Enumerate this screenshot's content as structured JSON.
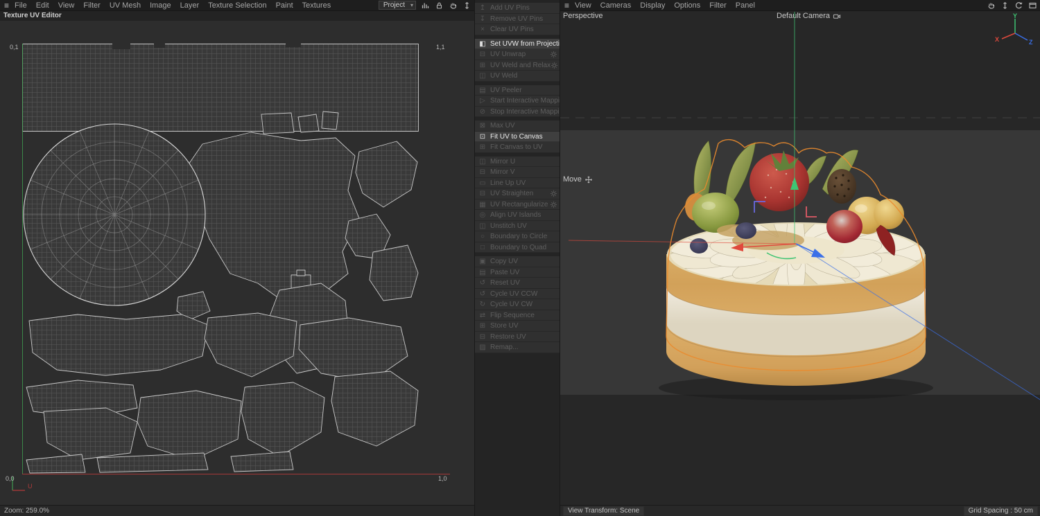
{
  "colors": {
    "selection_outline": "#ea8b2d",
    "axis_x": "#e0493d",
    "axis_y": "#3fc473",
    "axis_z": "#3a6fe8",
    "uv_axis_u": "#b23b3b",
    "uv_axis_v": "#3f9a4f"
  },
  "uv_editor": {
    "menu": [
      "File",
      "Edit",
      "View",
      "Filter",
      "UV Mesh",
      "Image",
      "Layer",
      "Texture Selection",
      "Paint",
      "Textures"
    ],
    "project_select": "Project",
    "toolbar_icons": [
      "histogram-icon",
      "lock-icon",
      "pan-hand-icon",
      "dolly-icon"
    ],
    "panel_title": "Texture UV Editor",
    "corner_labels": {
      "top_left": "0,1",
      "top_right": "1,1",
      "bottom_left": "0,0",
      "bottom_right": "1,0"
    },
    "u_axis_label": "U",
    "status_zoom": "Zoom: 259.0%"
  },
  "command_panel": {
    "groups": [
      {
        "items": [
          {
            "label": "Add UV Pins",
            "icon": "add-uv-pins-icon",
            "glyph": "↥",
            "enabled": false,
            "gear": false
          },
          {
            "label": "Remove UV Pins",
            "icon": "remove-uv-pins-icon",
            "glyph": "↧",
            "enabled": false,
            "gear": false
          },
          {
            "label": "Clear UV Pins",
            "icon": "clear-uv-pins-icon",
            "glyph": "×",
            "enabled": false,
            "gear": false
          }
        ]
      },
      {
        "items": [
          {
            "label": "Set UVW from Projection",
            "icon": "set-uvw-from-projection-icon",
            "glyph": "◧",
            "enabled": true,
            "gear": true
          },
          {
            "label": "UV Unwrap",
            "icon": "uv-unwrap-icon",
            "glyph": "⊟",
            "enabled": false,
            "gear": true
          },
          {
            "label": "UV Weld and Relax",
            "icon": "uv-weld-and-relax-icon",
            "glyph": "⊞",
            "enabled": false,
            "gear": true
          },
          {
            "label": "UV Weld",
            "icon": "uv-weld-icon",
            "glyph": "◫",
            "enabled": false,
            "gear": false
          }
        ]
      },
      {
        "items": [
          {
            "label": "UV Peeler",
            "icon": "uv-peeler-icon",
            "glyph": "▤",
            "enabled": false,
            "gear": false
          },
          {
            "label": "Start Interactive Mapping",
            "icon": "start-interactive-mapping-icon",
            "glyph": "▷",
            "enabled": false,
            "gear": false
          },
          {
            "label": "Stop Interactive Mapping",
            "icon": "stop-interactive-mapping-icon",
            "glyph": "⊘",
            "enabled": false,
            "gear": false
          }
        ]
      },
      {
        "items": [
          {
            "label": "Max UV",
            "icon": "max-uv-icon",
            "glyph": "⊠",
            "enabled": false,
            "gear": false
          },
          {
            "label": "Fit UV to Canvas",
            "icon": "fit-uv-to-canvas-icon",
            "glyph": "⊡",
            "enabled": true,
            "gear": false
          },
          {
            "label": "Fit Canvas to UV",
            "icon": "fit-canvas-to-uv-icon",
            "glyph": "⊞",
            "enabled": false,
            "gear": false
          }
        ]
      },
      {
        "items": [
          {
            "label": "Mirror U",
            "icon": "mirror-u-icon",
            "glyph": "◫",
            "enabled": false,
            "gear": false
          },
          {
            "label": "Mirror V",
            "icon": "mirror-v-icon",
            "glyph": "⊟",
            "enabled": false,
            "gear": false
          },
          {
            "label": "Line Up UV",
            "icon": "line-up-uv-icon",
            "glyph": "▭",
            "enabled": false,
            "gear": false
          },
          {
            "label": "UV Straighten",
            "icon": "uv-straighten-icon",
            "glyph": "⊟",
            "enabled": false,
            "gear": true
          },
          {
            "label": "UV Rectangularize",
            "icon": "uv-rectangularize-icon",
            "glyph": "▦",
            "enabled": false,
            "gear": true
          },
          {
            "label": "Align UV Islands",
            "icon": "align-uv-islands-icon",
            "glyph": "◎",
            "enabled": false,
            "gear": false
          },
          {
            "label": "Unstitch UV",
            "icon": "unstitch-uv-icon",
            "glyph": "◫",
            "enabled": false,
            "gear": false
          },
          {
            "label": "Boundary to Circle",
            "icon": "boundary-to-circle-icon",
            "glyph": "○",
            "enabled": false,
            "gear": false
          },
          {
            "label": "Boundary to Quad",
            "icon": "boundary-to-quad-icon",
            "glyph": "□",
            "enabled": false,
            "gear": false
          }
        ]
      },
      {
        "items": [
          {
            "label": "Copy UV",
            "icon": "copy-uv-icon",
            "glyph": "▣",
            "enabled": false,
            "gear": false
          },
          {
            "label": "Paste UV",
            "icon": "paste-uv-icon",
            "glyph": "▤",
            "enabled": false,
            "gear": false
          },
          {
            "label": "Reset UV",
            "icon": "reset-uv-icon",
            "glyph": "↺",
            "enabled": false,
            "gear": false
          },
          {
            "label": "Cycle UV CCW",
            "icon": "cycle-uv-ccw-icon",
            "glyph": "↺",
            "enabled": false,
            "gear": false
          },
          {
            "label": "Cycle UV CW",
            "icon": "cycle-uv-cw-icon",
            "glyph": "↻",
            "enabled": false,
            "gear": false
          },
          {
            "label": "Flip Sequence",
            "icon": "flip-sequence-icon",
            "glyph": "⇄",
            "enabled": false,
            "gear": false
          },
          {
            "label": "Store UV",
            "icon": "store-uv-icon",
            "glyph": "⊞",
            "enabled": false,
            "gear": false
          },
          {
            "label": "Restore UV",
            "icon": "restore-uv-icon",
            "glyph": "⊟",
            "enabled": false,
            "gear": false
          },
          {
            "label": "Remap...",
            "icon": "remap-icon",
            "glyph": "▨",
            "enabled": false,
            "gear": false
          }
        ]
      }
    ]
  },
  "viewport": {
    "menu": [
      "View",
      "Cameras",
      "Display",
      "Options",
      "Filter",
      "Panel"
    ],
    "toolbar_icons": [
      "pan-hand-icon",
      "dolly-icon",
      "orbit-icon",
      "maximize-icon"
    ],
    "projection_label": "Perspective",
    "camera_label": "Default Camera",
    "tool_label": "Move",
    "axis_labels": {
      "x": "X",
      "y": "Y",
      "z": "Z"
    },
    "status_view_transform": "View Transform: Scene",
    "status_grid_spacing": "Grid Spacing : 50 cm"
  }
}
